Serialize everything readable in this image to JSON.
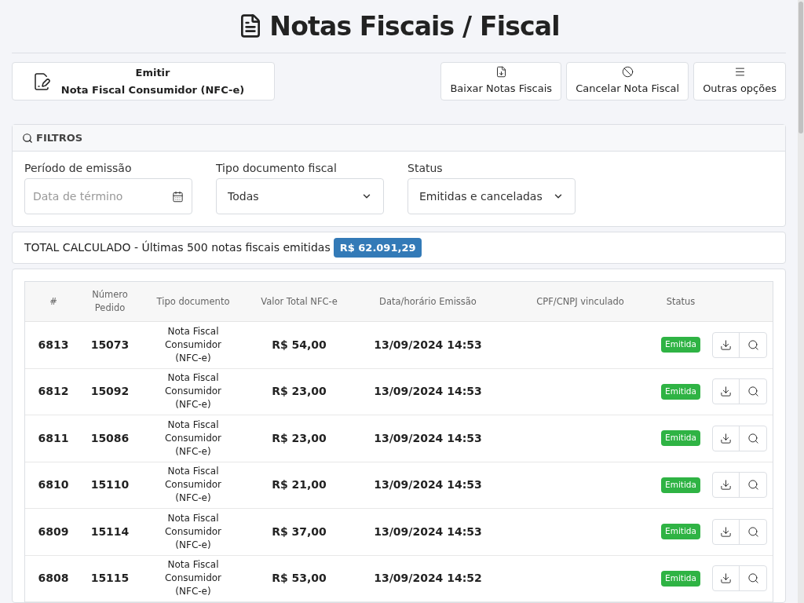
{
  "page_title": "Notas Fiscais / Fiscal",
  "emit_button": {
    "line1": "Emitir",
    "line2": "Nota Fiscal Consumidor (NFC-e)"
  },
  "actions": [
    {
      "kind": "download",
      "label": "Baixar Notas Fiscais"
    },
    {
      "kind": "cancel",
      "label": "Cancelar Nota Fiscal"
    },
    {
      "kind": "menu",
      "label": "Outras opções"
    }
  ],
  "filters": {
    "title": "FILTROS",
    "fields": [
      {
        "kind": "date",
        "label": "Período de emissão",
        "placeholder": "Data de término"
      },
      {
        "kind": "select",
        "label": "Tipo documento fiscal",
        "value": "Todas"
      },
      {
        "kind": "select",
        "label": "Status",
        "value": "Emitidas e canceladas"
      }
    ]
  },
  "total": {
    "label": "TOTAL CALCULADO - Últimas 500 notas fiscais emitidas",
    "value": "R$ 62.091,29"
  },
  "table": {
    "columns": [
      "#",
      "Número Pedido",
      "Tipo documento",
      "Valor Total NFC-e",
      "Data/horário Emissão",
      "CPF/CNPJ vinculado",
      "Status"
    ],
    "rows": [
      {
        "id": "6813",
        "order": "15073",
        "type": "Nota Fiscal Consumidor (NFC-e)",
        "value": "R$ 54,00",
        "date": "13/09/2024 14:53",
        "status": "Emitida"
      },
      {
        "id": "6812",
        "order": "15092",
        "type": "Nota Fiscal Consumidor (NFC-e)",
        "value": "R$ 23,00",
        "date": "13/09/2024 14:53",
        "status": "Emitida"
      },
      {
        "id": "6811",
        "order": "15086",
        "type": "Nota Fiscal Consumidor (NFC-e)",
        "value": "R$ 23,00",
        "date": "13/09/2024 14:53",
        "status": "Emitida"
      },
      {
        "id": "6810",
        "order": "15110",
        "type": "Nota Fiscal Consumidor (NFC-e)",
        "value": "R$ 21,00",
        "date": "13/09/2024 14:53",
        "status": "Emitida"
      },
      {
        "id": "6809",
        "order": "15114",
        "type": "Nota Fiscal Consumidor (NFC-e)",
        "value": "R$ 37,00",
        "date": "13/09/2024 14:53",
        "status": "Emitida"
      },
      {
        "id": "6808",
        "order": "15115",
        "type": "Nota Fiscal Consumidor (NFC-e)",
        "value": "R$ 53,00",
        "date": "13/09/2024 14:52",
        "status": "Emitida"
      }
    ]
  }
}
